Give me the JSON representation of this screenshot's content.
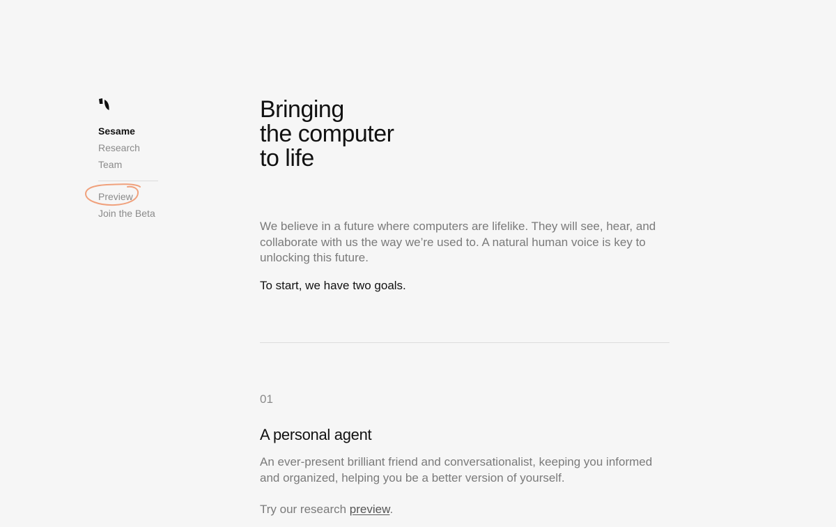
{
  "brand": {
    "logo_icon": "sesame-leaf-icon"
  },
  "sidebar": {
    "items": [
      {
        "label": "Sesame",
        "active": true
      },
      {
        "label": "Research",
        "active": false
      },
      {
        "label": "Team",
        "active": false
      }
    ],
    "secondary_items": [
      {
        "label": "Preview",
        "annotated": true
      },
      {
        "label": "Join the Beta",
        "annotated": false
      }
    ]
  },
  "hero": {
    "title_lines": [
      "Bringing",
      "the computer",
      "to life"
    ]
  },
  "intro": {
    "paragraph": "We believe in a future where computers are lifelike. They will see, hear, and collaborate with us the way we’re used to. A natural human voice is key to unlocking this future.",
    "goals": "To start, we have two goals."
  },
  "section": {
    "number": "01",
    "title": "A personal agent",
    "description": "An ever-present brilliant friend and conversationalist, keeping you informed and organized, helping you be a better version of yourself.",
    "cta_prefix": "Try our research ",
    "cta_link": "preview",
    "cta_suffix": "."
  },
  "colors": {
    "background": "#f6f6f6",
    "text_primary": "#111111",
    "text_muted": "#7a7a7a",
    "annotation": "#f0a17c"
  }
}
